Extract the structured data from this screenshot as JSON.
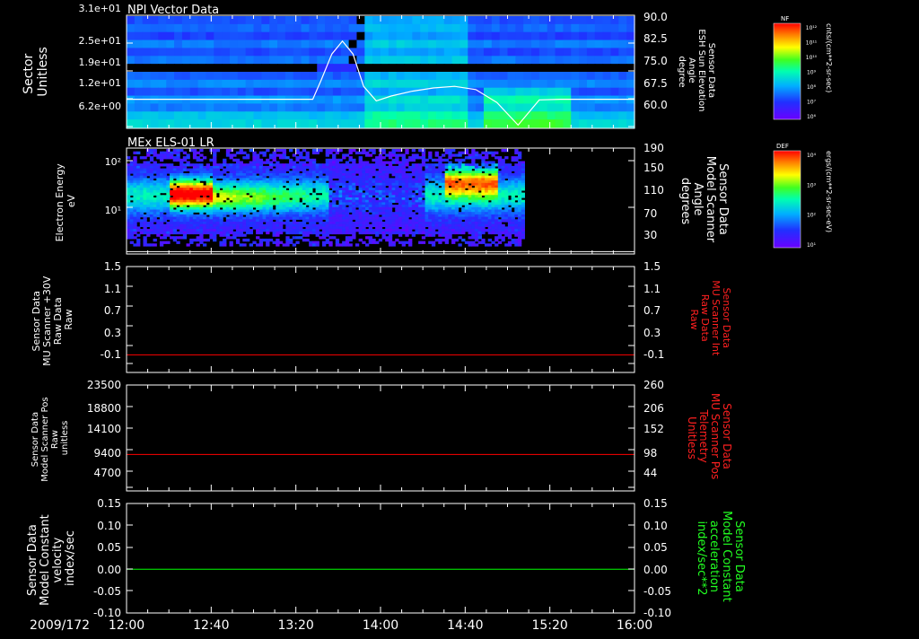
{
  "date_label": "2009/172",
  "time_axis": {
    "ticks": [
      "12:00",
      "12:40",
      "13:20",
      "14:00",
      "14:40",
      "15:20",
      "16:00"
    ],
    "range_minutes": [
      0,
      240
    ]
  },
  "colorbars": [
    {
      "header": "NF",
      "label": "cnts/(cm**2-sr-sec)",
      "ticks": [
        "10¹²",
        "10¹¹",
        "10¹⁰",
        "10⁹",
        "10⁸",
        "10⁷",
        "10⁶"
      ]
    },
    {
      "header": "DEF",
      "label": "ergs/(cm**2-sr-sec-eV)",
      "ticks": [
        "10⁴",
        "10³",
        "10²",
        "10¹"
      ]
    }
  ],
  "chart_data": [
    {
      "type": "heatmap",
      "title": "NPI Vector Data",
      "ylabel": [
        "Sector",
        "Unitless"
      ],
      "ytick_labels": [
        "3.1e+01",
        "2.5e+01",
        "1.9e+01",
        "1.2e+01",
        "6.2e+00"
      ],
      "ylabel_right": [
        "Sensor Data",
        "ESH Sun Elevation",
        "Angle",
        "degree"
      ],
      "ytick_labels_right": [
        "90.0",
        "82.5",
        "75.0",
        "67.5",
        "60.0"
      ],
      "ylim_right": [
        55,
        90
      ],
      "overlay_series": {
        "name": "ESH Sun Elevation Angle",
        "color": "#ffffff",
        "x_minutes": [
          0,
          88,
          92,
          97,
          102,
          107,
          112,
          118,
          125,
          135,
          145,
          155,
          165,
          175,
          185,
          195,
          205,
          215,
          220,
          225,
          230,
          235,
          240
        ],
        "y": [
          64.0,
          64.0,
          70.0,
          78.0,
          82.0,
          78.0,
          68.0,
          63.5,
          65.0,
          66.5,
          67.5,
          68.0,
          67.0,
          63.0,
          56.0,
          63.8,
          64.0,
          64.0,
          64.0,
          64.0,
          64.0,
          64.0,
          64.0
        ]
      }
    },
    {
      "type": "heatmap",
      "title": "MEx ELS-01 LR",
      "ylabel": [
        "Electron Energy",
        "eV"
      ],
      "ytick_labels": [
        "10²",
        "10¹"
      ],
      "ylabel_right": [
        "Sensor Data",
        "Model Scanner",
        "Angle",
        "degrees"
      ],
      "ytick_labels_right": [
        "190",
        "150",
        "110",
        "70",
        "30"
      ],
      "ylim_right": [
        10,
        190
      ],
      "data_end_minutes": 188,
      "overlay_series": {
        "name": "Model Scanner Angle",
        "color": "#ffffff",
        "value_right": 14
      }
    },
    {
      "type": "line",
      "ylabel": [
        "Sensor Data",
        "MU Scanner +30V",
        "Raw Data",
        "Raw"
      ],
      "ytick_labels": [
        "1.5",
        "1.1",
        "0.7",
        "0.3",
        "-0.1"
      ],
      "ylim": [
        -0.3,
        1.5
      ],
      "ylabel_right": [
        "Sensor Data",
        "MU Scanner Int",
        "Raw Data",
        "Raw"
      ],
      "ytick_labels_right": [
        "1.5",
        "1.1",
        "0.7",
        "0.3",
        "-0.1"
      ],
      "series": [
        {
          "name": "MU Scanner Int Raw Data",
          "color": "#ff0000",
          "value": 0.0
        }
      ]
    },
    {
      "type": "line",
      "ylabel": [
        "Sensor Data",
        "Model Scanner Pos",
        "Raw",
        "unitless"
      ],
      "ytick_labels": [
        "23500",
        "18800",
        "14100",
        "9400",
        "4700"
      ],
      "ylim": [
        0,
        23500
      ],
      "ylabel_right": [
        "Sensor Data",
        "MU Scanner Pos",
        "Telemetry",
        "Unitless"
      ],
      "ytick_labels_right": [
        "260",
        "206",
        "152",
        "98",
        "44"
      ],
      "ylim_right": [
        -10,
        260
      ],
      "series": [
        {
          "name": "MU Scanner Pos Telemetry",
          "color": "#ff0000",
          "value_right": 83
        }
      ]
    },
    {
      "type": "line",
      "ylabel": [
        "Sensor Data",
        "Model Constant",
        "velocity",
        "index/sec"
      ],
      "ytick_labels": [
        "0.15",
        "0.10",
        "0.05",
        "0.00",
        "-0.05",
        "-0.10"
      ],
      "ylim": [
        -0.1,
        0.15
      ],
      "ylabel_right": [
        "Sensor Data",
        "Model Constant",
        "acceleration",
        "index/sec**2"
      ],
      "ytick_labels_right": [
        "0.15",
        "0.10",
        "0.05",
        "0.00",
        "-0.05",
        "-0.10"
      ],
      "series": [
        {
          "name": "Model Constant acceleration",
          "color": "#00ff00",
          "value": 0.0
        }
      ]
    }
  ]
}
